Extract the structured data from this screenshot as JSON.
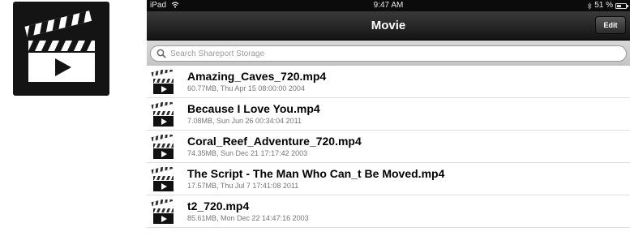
{
  "app_icon": {
    "icon": "movie-clapperboard-icon"
  },
  "status_bar": {
    "device": "iPad",
    "time": "9:47 AM",
    "battery": "51 %",
    "battery_level": 0.51
  },
  "nav": {
    "title": "Movie",
    "edit_label": "Edit"
  },
  "search": {
    "placeholder": "Search Shareport Storage"
  },
  "files": [
    {
      "name": "Amazing_Caves_720.mp4",
      "meta": "60.77MB, Thu Apr 15 08:00:00 2004"
    },
    {
      "name": "Because I Love You.mp4",
      "meta": "7.08MB, Sun Jun 26 00:34:04 2011"
    },
    {
      "name": "Coral_Reef_Adventure_720.mp4",
      "meta": "74.35MB, Sun Dec 21 17:17:42 2003"
    },
    {
      "name": "The Script - The Man Who Can_t Be Moved.mp4",
      "meta": "17.57MB, Thu Jul  7 17:41:08 2011"
    },
    {
      "name": "t2_720.mp4",
      "meta": "85.61MB, Mon Dec 22 14:47:16 2003"
    }
  ]
}
